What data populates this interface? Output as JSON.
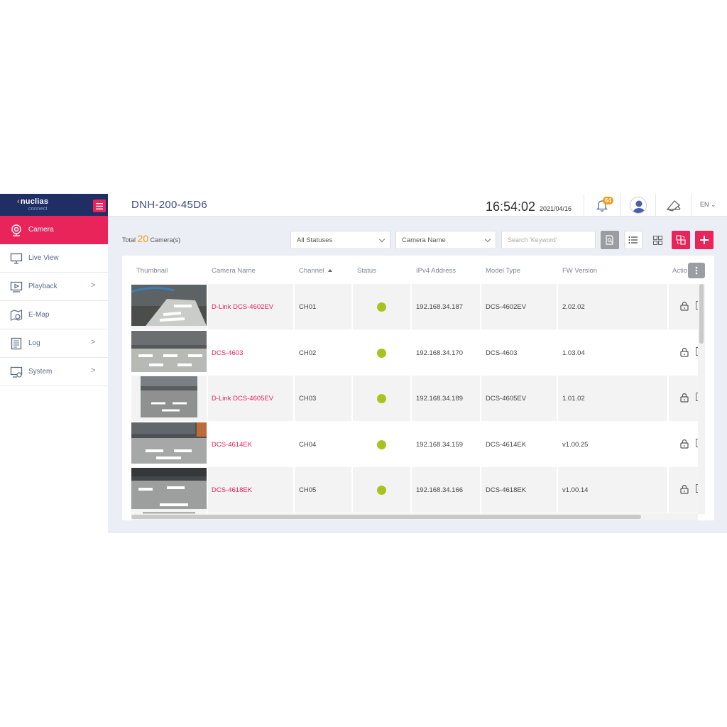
{
  "brand": {
    "logo": "nuclias",
    "sub": "connect"
  },
  "sidebar": {
    "items": [
      {
        "label": "Camera",
        "icon": "camera-icon",
        "active": true
      },
      {
        "label": "Live View",
        "icon": "monitor-icon"
      },
      {
        "label": "Playback",
        "icon": "playback-icon",
        "arrow": ">"
      },
      {
        "label": "E-Map",
        "icon": "map-icon"
      },
      {
        "label": "Log",
        "icon": "log-icon",
        "arrow": ">"
      },
      {
        "label": "System",
        "icon": "system-icon",
        "arrow": ">"
      }
    ]
  },
  "header": {
    "device": "DNH-200-45D6",
    "time": "16:54:02",
    "date": "2021/04/16",
    "notifications": "64",
    "lang": "EN"
  },
  "toolbar": {
    "total_prefix": "Total",
    "total_count": "20",
    "total_suffix": "Camera(s)",
    "status_filter": "All Statuses",
    "field_filter": "Camera Name",
    "search_placeholder": "Search 'Keyword'"
  },
  "table": {
    "columns": {
      "thumbnail": "Thumbnail",
      "name": "Camera Name",
      "channel": "Channel",
      "status": "Status",
      "ip": "IPv4 Address",
      "model": "Model Type",
      "fw": "FW Version",
      "action": "Actio"
    },
    "rows": [
      {
        "name": "D-Link DCS-4602EV",
        "channel": "CH01",
        "status": "online",
        "ip": "192.168.34.187",
        "model": "DCS-4602EV",
        "fw": "2.02.02"
      },
      {
        "name": "DCS-4603",
        "channel": "CH02",
        "status": "online",
        "ip": "192.168.34.170",
        "model": "DCS-4603",
        "fw": "1.03.04"
      },
      {
        "name": "D-Link DCS-4605EV",
        "channel": "CH03",
        "status": "online",
        "ip": "192.168.34.189",
        "model": "DCS-4605EV",
        "fw": "1.01.02"
      },
      {
        "name": "DCS-4614EK",
        "channel": "CH04",
        "status": "online",
        "ip": "192.168.34.159",
        "model": "DCS-4614EK",
        "fw": "v1.00.25"
      },
      {
        "name": "DCS-4618EK",
        "channel": "CH05",
        "status": "online",
        "ip": "192.168.34.166",
        "model": "DCS-4618EK",
        "fw": "v1.00.14"
      }
    ]
  },
  "colors": {
    "accent": "#e8245b",
    "brand": "#1f2f66",
    "online": "#a8c31f",
    "badge": "#f29b1c"
  }
}
